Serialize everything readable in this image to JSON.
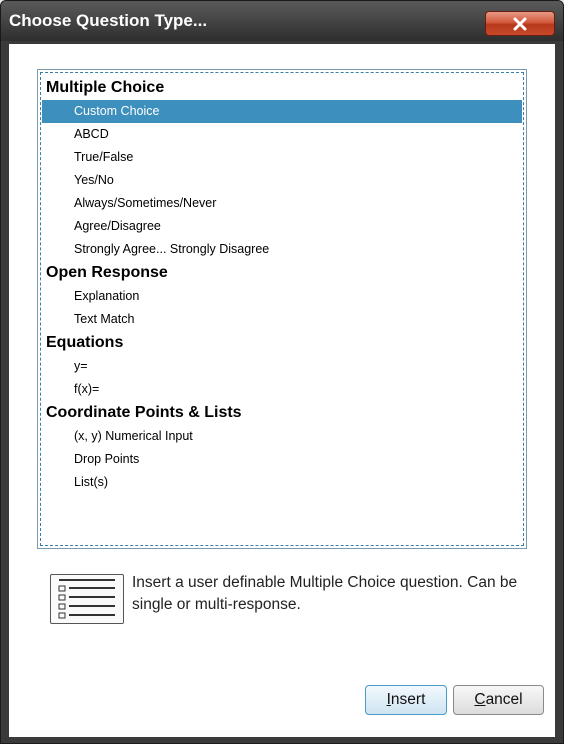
{
  "window": {
    "title": "Choose Question Type..."
  },
  "list": {
    "groups": [
      {
        "header": "Multiple Choice",
        "items": [
          "Custom Choice",
          "ABCD",
          "True/False",
          "Yes/No",
          "Always/Sometimes/Never",
          "Agree/Disagree",
          "Strongly Agree... Strongly Disagree"
        ]
      },
      {
        "header": "Open Response",
        "items": [
          "Explanation",
          "Text Match"
        ]
      },
      {
        "header": "Equations",
        "items": [
          "y=",
          "f(x)="
        ]
      },
      {
        "header": "Coordinate Points & Lists",
        "items": [
          "(x, y) Numerical Input",
          "Drop Points",
          "List(s)"
        ]
      }
    ],
    "selected": "Custom Choice"
  },
  "description": {
    "icon": "multiple-choice-list-icon",
    "text": "Insert a user definable Multiple Choice question. Can be single or multi-response."
  },
  "buttons": {
    "insert_mnemonic": "I",
    "insert_rest": "nsert",
    "cancel_mnemonic": "C",
    "cancel_rest": "ancel"
  },
  "colors": {
    "selection": "#3d8fbd",
    "close_button": "#c9492d",
    "titlebar": "#3a3a3a"
  }
}
